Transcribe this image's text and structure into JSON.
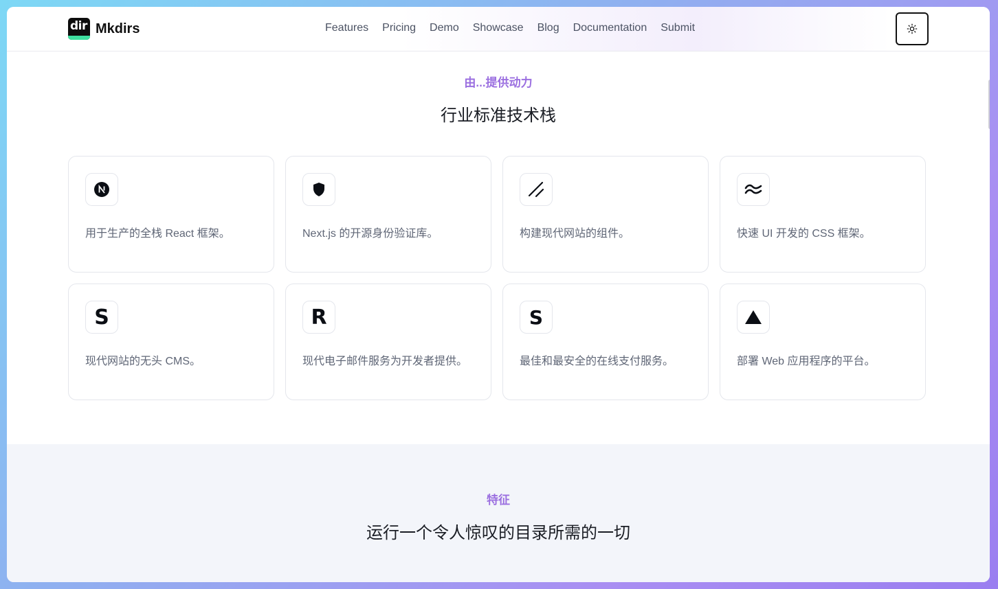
{
  "header": {
    "logo_text": "dir",
    "brand": "Mkdirs",
    "nav": [
      "Features",
      "Pricing",
      "Demo",
      "Showcase",
      "Blog",
      "Documentation",
      "Submit"
    ],
    "theme_icon": "sun-icon"
  },
  "tech": {
    "eyebrow": "由...提供动力",
    "title": "行业标准技术栈",
    "cards": [
      {
        "icon": "nextjs-icon",
        "glyph": "",
        "desc": "用于生产的全栈 React 框架。"
      },
      {
        "icon": "shield-icon",
        "glyph": "",
        "desc": "Next.js 的开源身份验证库。"
      },
      {
        "icon": "shadcn-icon",
        "glyph": "",
        "desc": "构建现代网站的组件。"
      },
      {
        "icon": "tailwind-icon",
        "glyph": "",
        "desc": "快速 UI 开发的 CSS 框架。"
      },
      {
        "icon": "sanity-icon",
        "glyph": "S",
        "desc": "现代网站的无头 CMS。"
      },
      {
        "icon": "resend-icon",
        "glyph": "R",
        "desc": "现代电子邮件服务为开发者提供。"
      },
      {
        "icon": "stripe-icon",
        "glyph": "S",
        "desc": "最佳和最安全的在线支付服务。"
      },
      {
        "icon": "vercel-icon",
        "glyph": "",
        "desc": "部署 Web 应用程序的平台。"
      }
    ]
  },
  "features": {
    "eyebrow": "特征",
    "title": "运行一个令人惊叹的目录所需的一切"
  }
}
